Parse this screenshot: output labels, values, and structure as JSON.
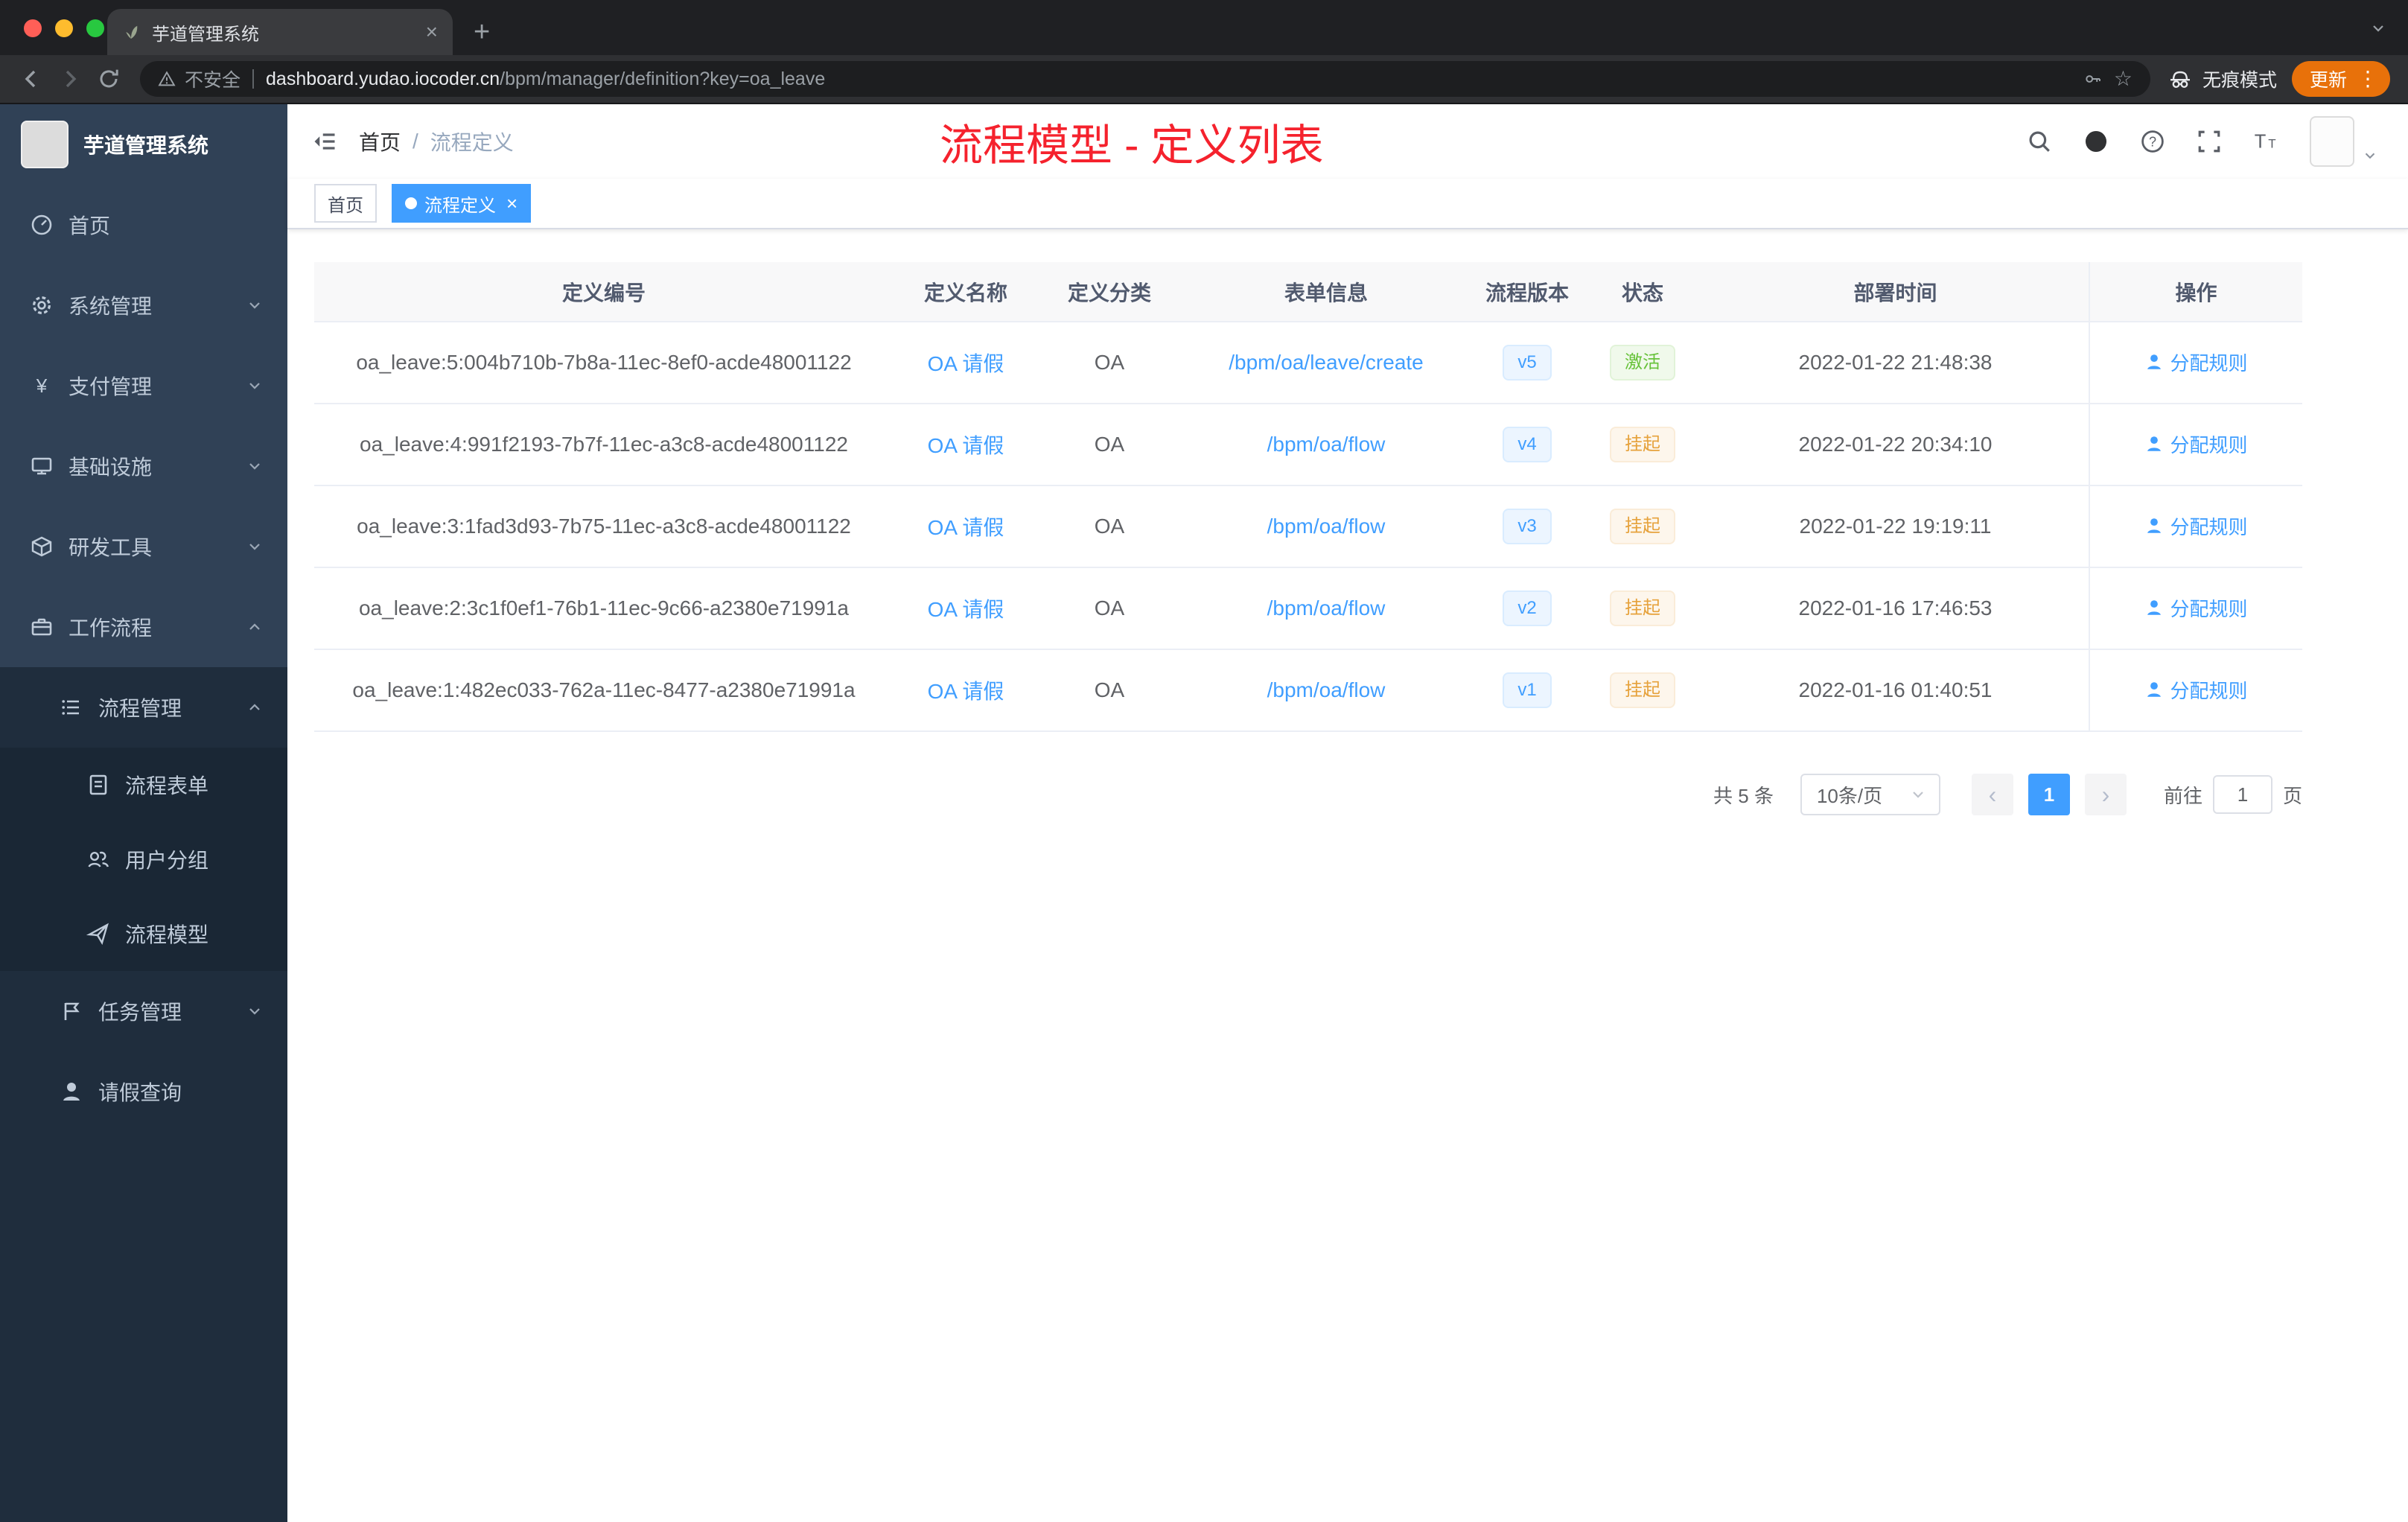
{
  "colors": {
    "accent": "#409eff",
    "annotation_red": "#f5222d",
    "success": "#67c23a",
    "warning": "#e6a23c",
    "sidebar_bg": "#304156",
    "submenu_bg": "#1f2d3d"
  },
  "browser": {
    "tab": {
      "title": "芋道管理系统",
      "close": "×",
      "new_tab": "+"
    },
    "address": {
      "security_label": "不安全",
      "host": "dashboard.yudao.iocoder.cn",
      "path": "/bpm/manager/definition?key=oa_leave"
    },
    "incognito_label": "无痕模式",
    "update_label": "更新",
    "glyphs": {
      "star": "☆",
      "kebab": "⋮"
    }
  },
  "sidebar": {
    "logo_title": "芋道管理系统",
    "items": [
      {
        "label": "首页"
      },
      {
        "label": "系统管理"
      },
      {
        "label": "支付管理"
      },
      {
        "label": "基础设施"
      },
      {
        "label": "研发工具"
      },
      {
        "label": "工作流程"
      }
    ],
    "submenu": {
      "label": "流程管理",
      "children": [
        {
          "label": "流程表单"
        },
        {
          "label": "用户分组"
        },
        {
          "label": "流程模型"
        }
      ]
    },
    "tail_items": [
      {
        "label": "任务管理"
      },
      {
        "label": "请假查询"
      }
    ]
  },
  "header": {
    "breadcrumb": {
      "home": "首页",
      "separator": "/",
      "current": "流程定义"
    },
    "annotation": "流程模型 - 定义列表"
  },
  "tags": {
    "inactive": "首页",
    "active": "流程定义",
    "close": "×"
  },
  "table": {
    "headers": [
      "定义编号",
      "定义名称",
      "定义分类",
      "表单信息",
      "流程版本",
      "状态",
      "部署时间",
      "操作"
    ],
    "rows": [
      {
        "id": "oa_leave:5:004b710b-7b8a-11ec-8ef0-acde48001122",
        "name": "OA 请假",
        "category": "OA",
        "form": "/bpm/oa/leave/create",
        "version": "v5",
        "status": "激活",
        "status_type": "success",
        "time": "2022-01-22 21:48:38",
        "action": "分配规则"
      },
      {
        "id": "oa_leave:4:991f2193-7b7f-11ec-a3c8-acde48001122",
        "name": "OA 请假",
        "category": "OA",
        "form": "/bpm/oa/flow",
        "version": "v4",
        "status": "挂起",
        "status_type": "warning",
        "time": "2022-01-22 20:34:10",
        "action": "分配规则"
      },
      {
        "id": "oa_leave:3:1fad3d93-7b75-11ec-a3c8-acde48001122",
        "name": "OA 请假",
        "category": "OA",
        "form": "/bpm/oa/flow",
        "version": "v3",
        "status": "挂起",
        "status_type": "warning",
        "time": "2022-01-22 19:19:11",
        "action": "分配规则"
      },
      {
        "id": "oa_leave:2:3c1f0ef1-76b1-11ec-9c66-a2380e71991a",
        "name": "OA 请假",
        "category": "OA",
        "form": "/bpm/oa/flow",
        "version": "v2",
        "status": "挂起",
        "status_type": "warning",
        "time": "2022-01-16 17:46:53",
        "action": "分配规则"
      },
      {
        "id": "oa_leave:1:482ec033-762a-11ec-8477-a2380e71991a",
        "name": "OA 请假",
        "category": "OA",
        "form": "/bpm/oa/flow",
        "version": "v1",
        "status": "挂起",
        "status_type": "warning",
        "time": "2022-01-16 01:40:51",
        "action": "分配规则"
      }
    ]
  },
  "pagination": {
    "total": "共 5 条",
    "page_size": "10条/页",
    "prev": "‹",
    "page": "1",
    "next": "›",
    "goto_label": "前往",
    "goto_value": "1",
    "page_unit": "页"
  }
}
